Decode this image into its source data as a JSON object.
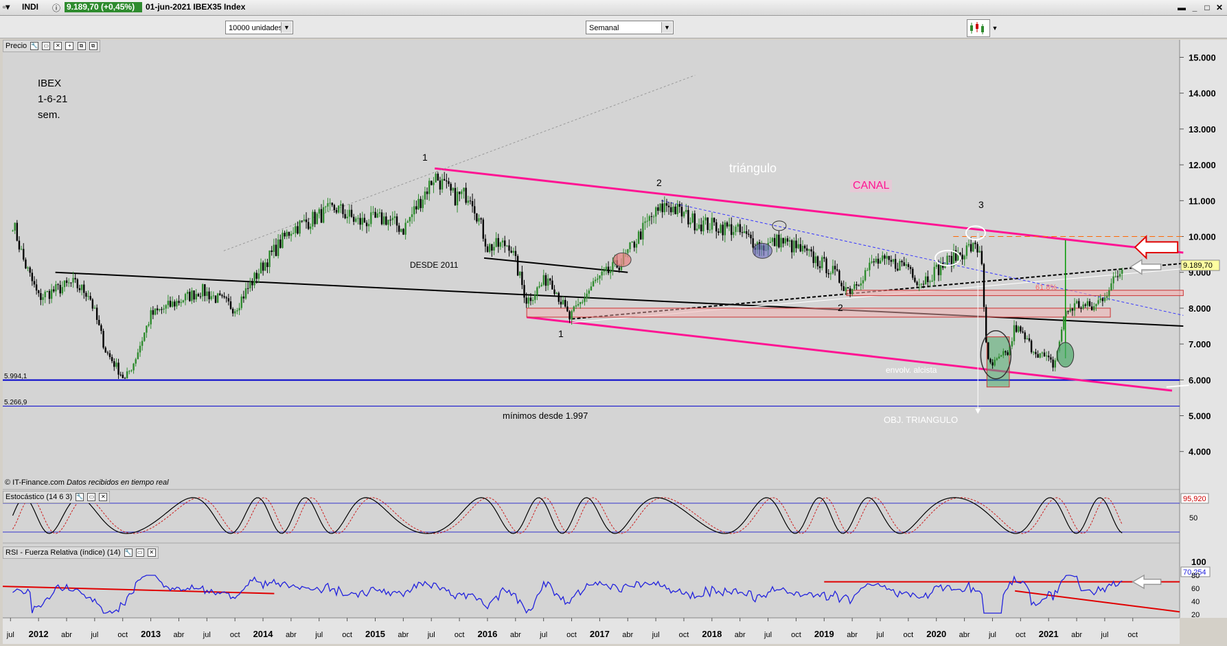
{
  "window": {
    "title_icon": "chart-window-icon",
    "symbol": "INDI",
    "last_price_badge": "9.189,70 (+0,45%)",
    "header_info": "01-jun-2021 IBEX35 Index"
  },
  "toolbar": {
    "units_select": "10000 unidades",
    "period_select": "Semanal"
  },
  "panes": {
    "price_label": "Precio",
    "stoch_label": "Estocástico (14 6 3)",
    "rsi_label": "RSI - Fuerza Relativa (índice) (14)"
  },
  "credit": {
    "source": "© IT-Finance.com",
    "realtime": "Datos recibidos en tiempo real"
  },
  "annotations": {
    "corner_lines": [
      "IBEX",
      "1-6-21",
      "sem."
    ],
    "wave1_top": "1",
    "wave2_top": "2",
    "wave3_top": "3",
    "wave1_bottom": "1",
    "wave2_bottom": "2",
    "triangle": "triángulo",
    "channel": "CANAL",
    "since_2011": "DESDE  2011",
    "mins_since": "mínimos desde 1.997",
    "envelope": "envolv. alcista",
    "triangle_target": "OBJ. TRIANGULO",
    "level_5994": "5.994,1",
    "level_5266": "5.266,9",
    "fib_label": "61,8%"
  },
  "colors": {
    "up": "#2e8b2e",
    "down": "#000000",
    "channel": "#ff1493",
    "trend": "#000000",
    "support_blue": "#0000cc",
    "rsi_line": "#2222dd",
    "stoch_k": "#000000",
    "stoch_d": "#cc2222",
    "red_arrow": "#e00000"
  },
  "chart_data": [
    {
      "type": "candlestick",
      "pane": "price",
      "x_ticks": [
        "jul",
        "2012",
        "abr",
        "jul",
        "oct",
        "2013",
        "abr",
        "jul",
        "oct",
        "2014",
        "abr",
        "jul",
        "oct",
        "2015",
        "abr",
        "jul",
        "oct",
        "2016",
        "abr",
        "jul",
        "oct",
        "2017",
        "abr",
        "jul",
        "oct",
        "2018",
        "abr",
        "jul",
        "oct",
        "2019",
        "abr",
        "jul",
        "oct",
        "2020",
        "abr",
        "jul",
        "oct",
        "2021",
        "abr",
        "jul",
        "oct"
      ],
      "y_ticks": [
        "15.000",
        "14.000",
        "13.000",
        "12.000",
        "11.000",
        "10.000",
        "9.000",
        "8.000",
        "7.000",
        "6.000",
        "5.000",
        "4.000"
      ],
      "y_range": [
        3300,
        15300
      ],
      "last_value_label": "9.189,70",
      "anchors": [
        {
          "t": 2011.52,
          "v": 10400
        },
        {
          "t": 2011.62,
          "v": 9300
        },
        {
          "t": 2011.75,
          "v": 8300
        },
        {
          "t": 2011.9,
          "v": 8500
        },
        {
          "t": 2012.05,
          "v": 8700
        },
        {
          "t": 2012.2,
          "v": 8400
        },
        {
          "t": 2012.35,
          "v": 6800
        },
        {
          "t": 2012.52,
          "v": 6000
        },
        {
          "t": 2012.6,
          "v": 6500
        },
        {
          "t": 2012.75,
          "v": 7800
        },
        {
          "t": 2013.0,
          "v": 8200
        },
        {
          "t": 2013.2,
          "v": 8500
        },
        {
          "t": 2013.5,
          "v": 8000
        },
        {
          "t": 2013.75,
          "v": 9200
        },
        {
          "t": 2014.0,
          "v": 10200
        },
        {
          "t": 2014.4,
          "v": 10800
        },
        {
          "t": 2014.6,
          "v": 10400
        },
        {
          "t": 2014.85,
          "v": 10500
        },
        {
          "t": 2015.0,
          "v": 10200
        },
        {
          "t": 2015.28,
          "v": 11700
        },
        {
          "t": 2015.45,
          "v": 11100
        },
        {
          "t": 2015.6,
          "v": 11200
        },
        {
          "t": 2015.75,
          "v": 9700
        },
        {
          "t": 2015.95,
          "v": 9800
        },
        {
          "t": 2016.1,
          "v": 8200
        },
        {
          "t": 2016.3,
          "v": 8900
        },
        {
          "t": 2016.48,
          "v": 7700
        },
        {
          "t": 2016.7,
          "v": 8700
        },
        {
          "t": 2016.95,
          "v": 9300
        },
        {
          "t": 2017.2,
          "v": 10500
        },
        {
          "t": 2017.35,
          "v": 10900
        },
        {
          "t": 2017.6,
          "v": 10400
        },
        {
          "t": 2017.95,
          "v": 10200
        },
        {
          "t": 2018.2,
          "v": 9700
        },
        {
          "t": 2018.35,
          "v": 9900
        },
        {
          "t": 2018.55,
          "v": 9600
        },
        {
          "t": 2018.8,
          "v": 9100
        },
        {
          "t": 2018.97,
          "v": 8500
        },
        {
          "t": 2019.2,
          "v": 9300
        },
        {
          "t": 2019.5,
          "v": 9200
        },
        {
          "t": 2019.6,
          "v": 8700
        },
        {
          "t": 2019.85,
          "v": 9300
        },
        {
          "t": 2020.05,
          "v": 9700
        },
        {
          "t": 2020.15,
          "v": 9600
        },
        {
          "t": 2020.2,
          "v": 6500
        },
        {
          "t": 2020.25,
          "v": 6400
        },
        {
          "t": 2020.4,
          "v": 6800
        },
        {
          "t": 2020.45,
          "v": 7500
        },
        {
          "t": 2020.6,
          "v": 6900
        },
        {
          "t": 2020.8,
          "v": 6400
        },
        {
          "t": 2020.9,
          "v": 7900
        },
        {
          "t": 2021.0,
          "v": 8100
        },
        {
          "t": 2021.15,
          "v": 8000
        },
        {
          "t": 2021.3,
          "v": 8600
        },
        {
          "t": 2021.42,
          "v": 9190
        }
      ],
      "channel_upper": [
        {
          "t": 2015.28,
          "v": 11900
        },
        {
          "t": 2021.95,
          "v": 9550
        }
      ],
      "channel_lower": [
        {
          "t": 2016.1,
          "v": 7750
        },
        {
          "t": 2021.85,
          "v": 5700
        }
      ],
      "support_levels": [
        5994.1,
        5266.9
      ]
    },
    {
      "type": "line",
      "pane": "stochastic",
      "name": "Estocástico (14 6 3)",
      "y_ticks": [
        "50"
      ],
      "last_value_label": "95,920"
    },
    {
      "type": "line",
      "pane": "rsi",
      "name": "RSI - Fuerza Relativa (índice) (14)",
      "y_ticks": [
        "100",
        "80",
        "60",
        "40",
        "20"
      ],
      "last_value_label": "70,254"
    }
  ]
}
